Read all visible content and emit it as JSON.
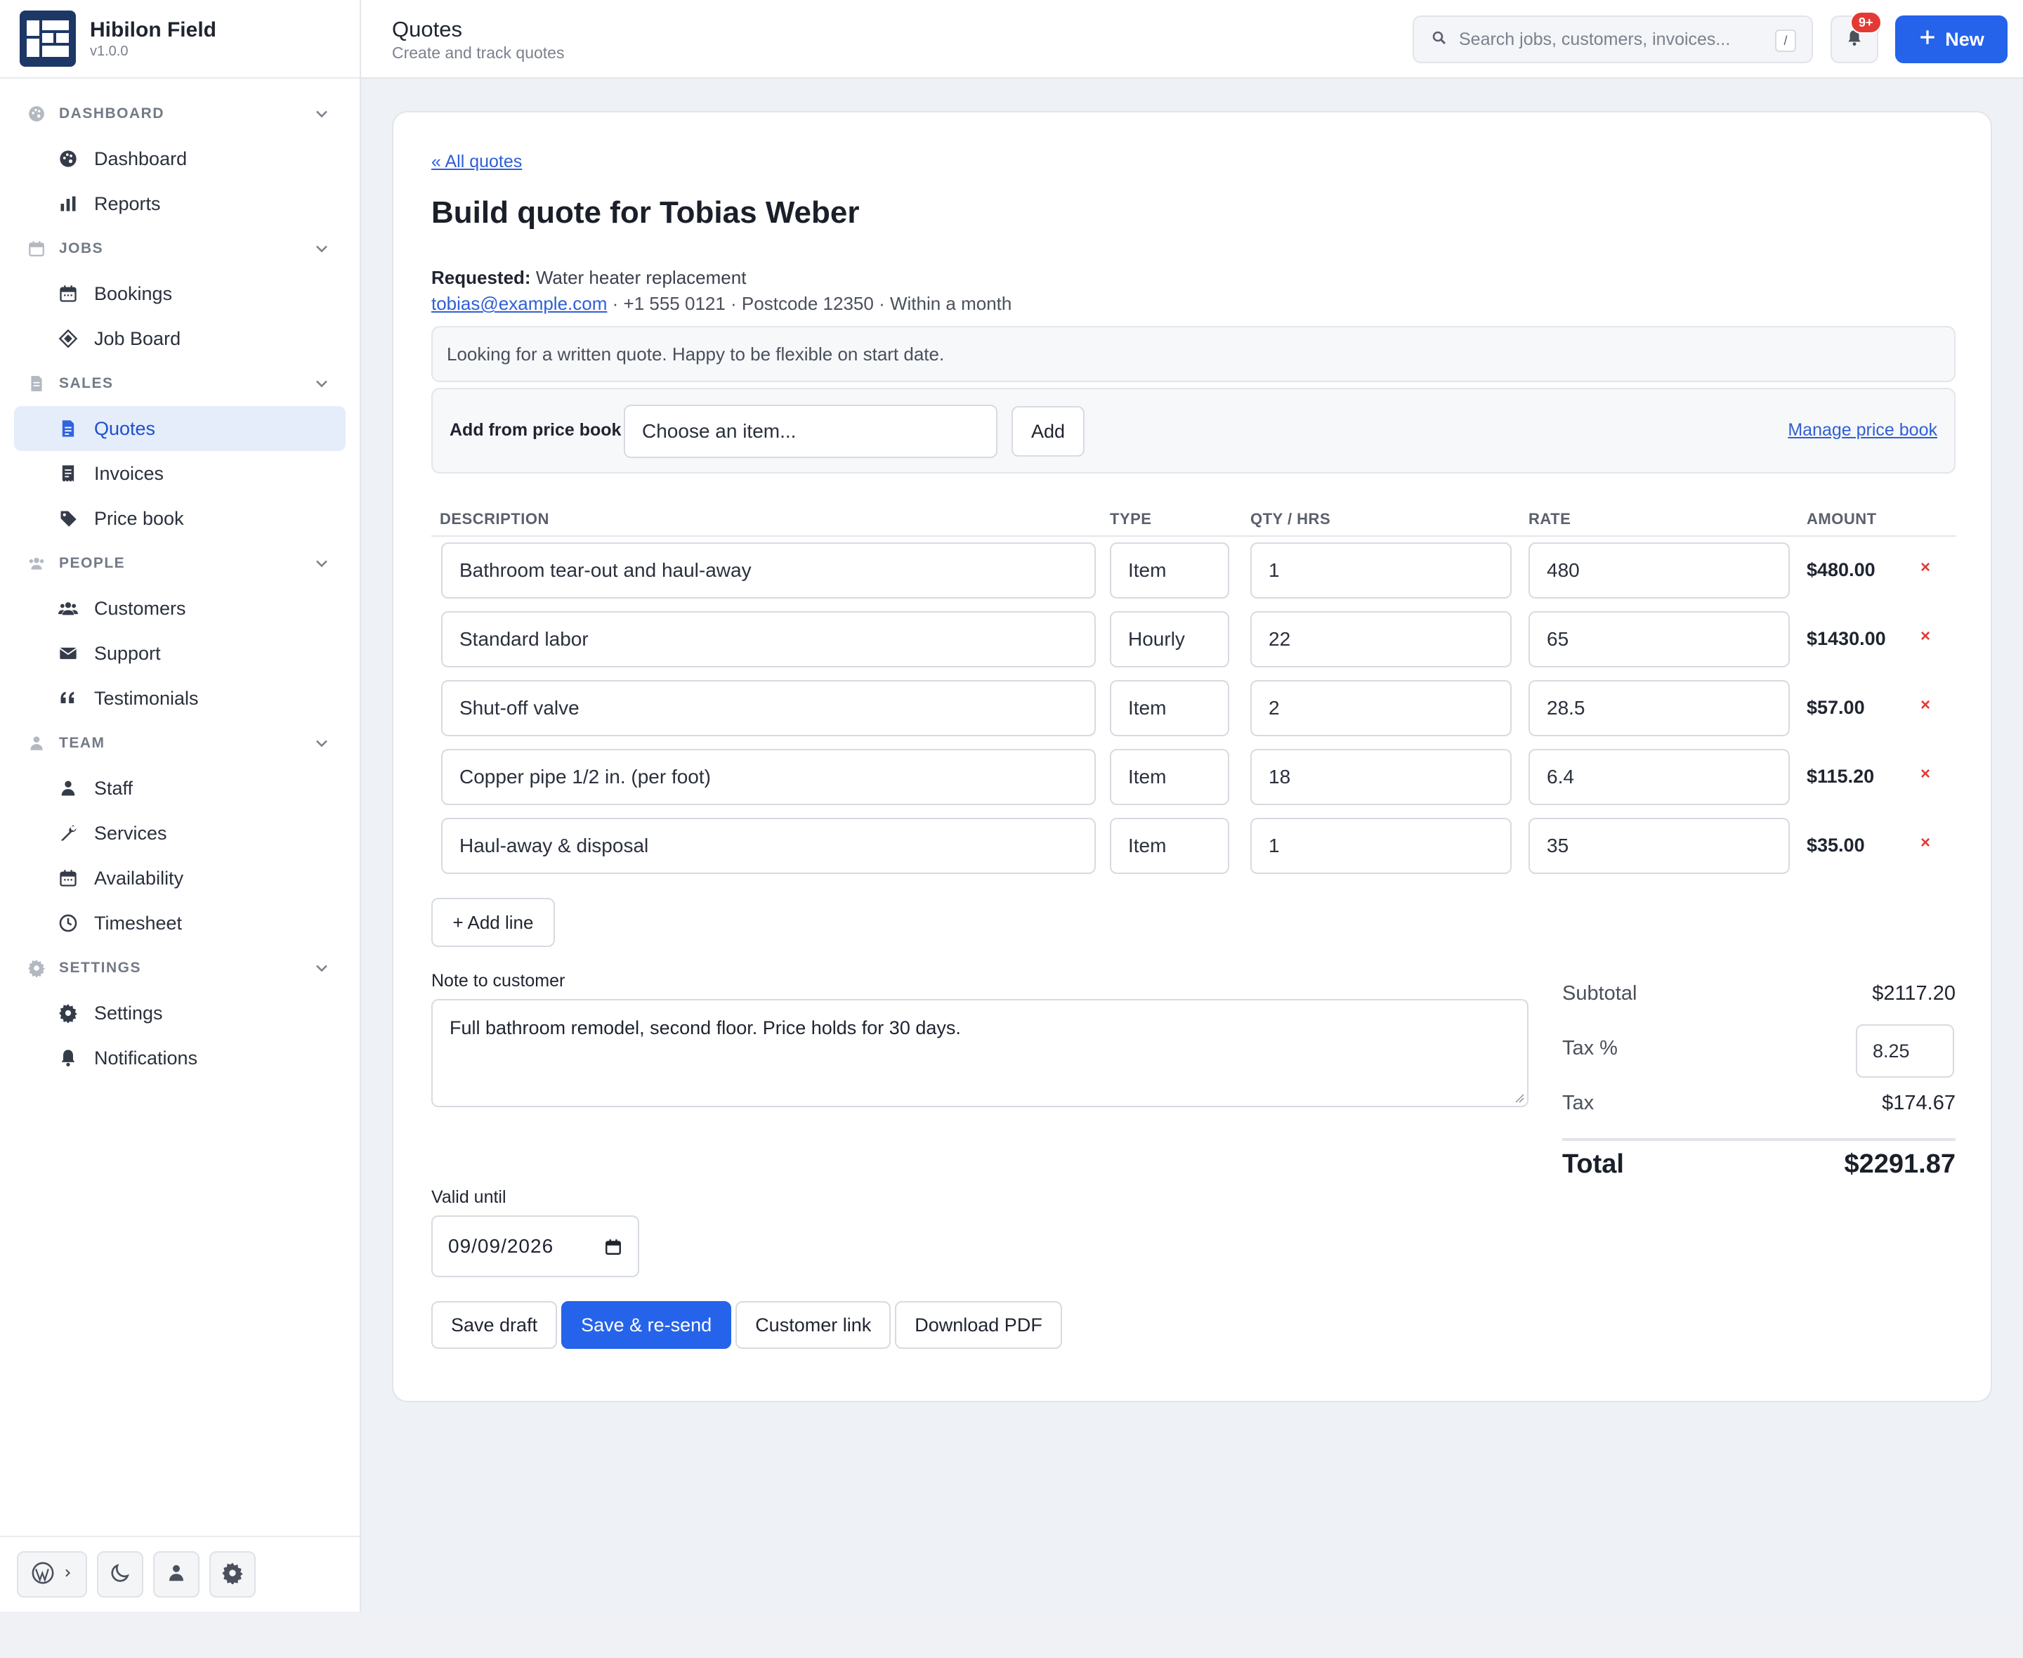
{
  "app": {
    "name": "Hibilon Field",
    "version": "v1.0.0"
  },
  "sidebar": {
    "sections": [
      {
        "label": "DASHBOARD",
        "items": [
          "Dashboard",
          "Reports"
        ]
      },
      {
        "label": "JOBS",
        "items": [
          "Bookings",
          "Job Board"
        ]
      },
      {
        "label": "SALES",
        "items": [
          "Quotes",
          "Invoices",
          "Price book"
        ]
      },
      {
        "label": "PEOPLE",
        "items": [
          "Customers",
          "Support",
          "Testimonials"
        ]
      },
      {
        "label": "TEAM",
        "items": [
          "Staff",
          "Services",
          "Availability",
          "Timesheet"
        ]
      },
      {
        "label": "SETTINGS",
        "items": [
          "Settings",
          "Notifications"
        ]
      }
    ],
    "active_item": "Quotes"
  },
  "header": {
    "title": "Quotes",
    "subtitle": "Create and track quotes",
    "search_placeholder": "Search jobs, customers, invoices...",
    "search_shortcut": "/",
    "notification_badge": "9+",
    "new_label": "New"
  },
  "quote": {
    "back_link": "« All quotes",
    "heading": "Build quote for Tobias Weber",
    "requested_label": "Requested:",
    "requested_value": "Water heater replacement",
    "email": "tobias@example.com",
    "contact_rest": "· +1 555 0121 · Postcode 12350 · Within a month",
    "message": "Looking for a written quote. Happy to be flexible on start date.",
    "price_book": {
      "label": "Add from price book",
      "select_placeholder": "Choose an item...",
      "add_label": "Add",
      "manage_label": "Manage price book"
    },
    "columns": [
      "DESCRIPTION",
      "TYPE",
      "QTY / HRS",
      "RATE",
      "AMOUNT"
    ],
    "lines": [
      {
        "description": "Bathroom tear-out and haul-away",
        "type": "Item",
        "qty": "1",
        "rate": "480",
        "amount": "$480.00"
      },
      {
        "description": "Standard labor",
        "type": "Hourly",
        "qty": "22",
        "rate": "65",
        "amount": "$1430.00"
      },
      {
        "description": "Shut-off valve",
        "type": "Item",
        "qty": "2",
        "rate": "28.5",
        "amount": "$57.00"
      },
      {
        "description": "Copper pipe 1/2 in. (per foot)",
        "type": "Item",
        "qty": "18",
        "rate": "6.4",
        "amount": "$115.20"
      },
      {
        "description": "Haul-away & disposal",
        "type": "Item",
        "qty": "1",
        "rate": "35",
        "amount": "$35.00"
      }
    ],
    "remove_symbol": "×",
    "add_line_label": "+ Add line",
    "note_label": "Note to customer",
    "note_value": "Full bathroom remodel, second floor. Price holds for 30 days.",
    "totals": {
      "subtotal_label": "Subtotal",
      "subtotal": "$2117.20",
      "tax_pct_label": "Tax %",
      "tax_pct": "8.25",
      "tax_label": "Tax",
      "tax": "$174.67",
      "total_label": "Total",
      "total": "$2291.87"
    },
    "valid_until_label": "Valid until",
    "valid_until": "09/09/2026",
    "actions": {
      "save_draft": "Save draft",
      "save_resend": "Save & re-send",
      "customer_link": "Customer link",
      "download_pdf": "Download PDF"
    }
  },
  "colors": {
    "accent": "#2563eb",
    "brand": "#1d3766",
    "danger": "#e53935",
    "link": "#2f5fd6"
  }
}
